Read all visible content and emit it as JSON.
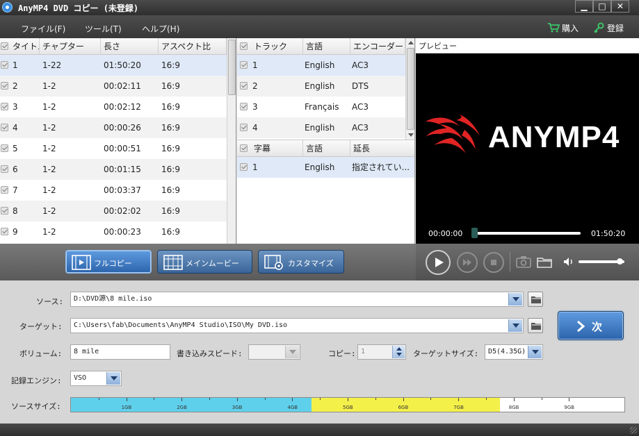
{
  "window": {
    "title": "AnyMP4 DVD コピー (未登録)",
    "controls": {
      "minimize": "▁",
      "maximize": "□",
      "close": "✕"
    }
  },
  "menu": {
    "file": "ファイル(F)",
    "tools": "ツール(T)",
    "help": "ヘルプ(H)",
    "buy": "購入",
    "register": "登録"
  },
  "titles": {
    "columns": [
      "タイトル",
      "チャプター",
      "長さ",
      "アスペクト比"
    ],
    "rows": [
      {
        "title": "1",
        "chapters": "1-22",
        "length": "01:50:20",
        "aspect": "16:9"
      },
      {
        "title": "2",
        "chapters": "1-2",
        "length": "00:02:11",
        "aspect": "16:9"
      },
      {
        "title": "3",
        "chapters": "1-2",
        "length": "00:02:12",
        "aspect": "16:9"
      },
      {
        "title": "4",
        "chapters": "1-2",
        "length": "00:00:26",
        "aspect": "16:9"
      },
      {
        "title": "5",
        "chapters": "1-2",
        "length": "00:00:51",
        "aspect": "16:9"
      },
      {
        "title": "6",
        "chapters": "1-2",
        "length": "00:01:15",
        "aspect": "16:9"
      },
      {
        "title": "7",
        "chapters": "1-2",
        "length": "00:03:37",
        "aspect": "16:9"
      },
      {
        "title": "8",
        "chapters": "1-2",
        "length": "00:02:02",
        "aspect": "16:9"
      },
      {
        "title": "9",
        "chapters": "1-2",
        "length": "00:00:23",
        "aspect": "16:9"
      }
    ]
  },
  "tracks": {
    "columns": [
      "トラック",
      "言語",
      "エンコーダー"
    ],
    "rows": [
      {
        "track": "1",
        "language": "English",
        "encoder": "AC3"
      },
      {
        "track": "2",
        "language": "English",
        "encoder": "DTS"
      },
      {
        "track": "3",
        "language": "Français",
        "encoder": "AC3"
      },
      {
        "track": "4",
        "language": "English",
        "encoder": "AC3"
      }
    ]
  },
  "subtitles": {
    "columns": [
      "字幕",
      "言語",
      "延長"
    ],
    "rows": [
      {
        "subtitle": "1",
        "language": "English",
        "extension": "指定されてい..."
      }
    ]
  },
  "preview": {
    "label": "プレビュー",
    "logo_text": "ANYMP4",
    "time_current": "00:00:00",
    "time_total": "01:50:20",
    "seek_fraction": 0.0,
    "volume_fraction": 0.9
  },
  "modes": {
    "full": "フルコピー",
    "main": "メインムービー",
    "custom": "カスタマイズ"
  },
  "settings": {
    "source_label": "ソース:",
    "source_value": "D:\\DVD源\\8 mile.iso",
    "target_label": "ターゲット:",
    "target_value": "C:\\Users\\fab\\Documents\\AnyMP4 Studio\\ISO\\My DVD.iso",
    "volume_label": "ボリューム:",
    "volume_value": "8 mile",
    "write_speed_label": "書き込みスピード:",
    "write_speed_value": "",
    "copies_label": "コピー:",
    "copies_value": "1",
    "target_size_label": "ターゲットサイズ:",
    "target_size_value": "D5(4.35G)",
    "engine_label": "記録エンジン:",
    "engine_value": "VSO",
    "source_size_label": "ソースサイズ:",
    "next_button": "次"
  },
  "capacity": {
    "ticks": [
      "1GB",
      "2GB",
      "3GB",
      "4GB",
      "5GB",
      "6GB",
      "7GB",
      "8GB",
      "9GB"
    ],
    "max_gb": 10,
    "blue_gb": 4.35,
    "yellow_gb": 7.75,
    "colors": {
      "within": "#5fd0eb",
      "over": "#f4f04a"
    }
  },
  "colors": {
    "accent": "#2c64ab",
    "logo_red": "#e02424"
  }
}
